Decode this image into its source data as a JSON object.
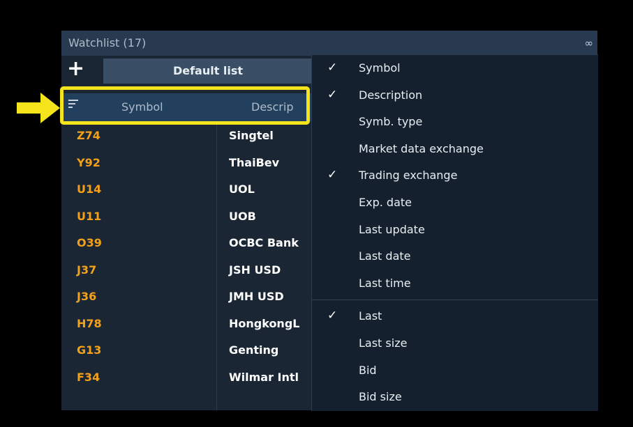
{
  "watchlist": {
    "title": "Watchlist (17)",
    "add_label": "+",
    "list_name": "Default list",
    "columns": {
      "symbol": "Symbol",
      "description": "Descrip"
    },
    "rows": [
      {
        "symbol": "Z74",
        "description": "Singtel"
      },
      {
        "symbol": "Y92",
        "description": "ThaiBev"
      },
      {
        "symbol": "U14",
        "description": "UOL"
      },
      {
        "symbol": "U11",
        "description": "UOB"
      },
      {
        "symbol": "O39",
        "description": "OCBC Bank"
      },
      {
        "symbol": "J37",
        "description": "JSH USD"
      },
      {
        "symbol": "J36",
        "description": "JMH USD"
      },
      {
        "symbol": "H78",
        "description": "HongkongL"
      },
      {
        "symbol": "G13",
        "description": "Genting"
      },
      {
        "symbol": "F34",
        "description": "Wilmar Intl"
      }
    ]
  },
  "icons": {
    "link": "link-icon",
    "sort": "sort-icon",
    "arrow": "arrow-icon",
    "check": "✓"
  },
  "colors": {
    "symbol_text": "#f3a11a",
    "highlight": "#f5e31c",
    "panel_bg": "#1a2634",
    "menu_bg": "#15202e"
  },
  "menu": {
    "group1": [
      {
        "label": "Symbol",
        "checked": true
      },
      {
        "label": "Description",
        "checked": true
      },
      {
        "label": "Symb. type",
        "checked": false
      },
      {
        "label": "Market data exchange",
        "checked": false
      },
      {
        "label": "Trading exchange",
        "checked": true
      },
      {
        "label": "Exp. date",
        "checked": false
      },
      {
        "label": "Last update",
        "checked": false
      },
      {
        "label": "Last date",
        "checked": false
      },
      {
        "label": "Last time",
        "checked": false
      }
    ],
    "group2": [
      {
        "label": "Last",
        "checked": true
      },
      {
        "label": "Last size",
        "checked": false
      },
      {
        "label": "Bid",
        "checked": false
      },
      {
        "label": "Bid size",
        "checked": false
      }
    ]
  }
}
